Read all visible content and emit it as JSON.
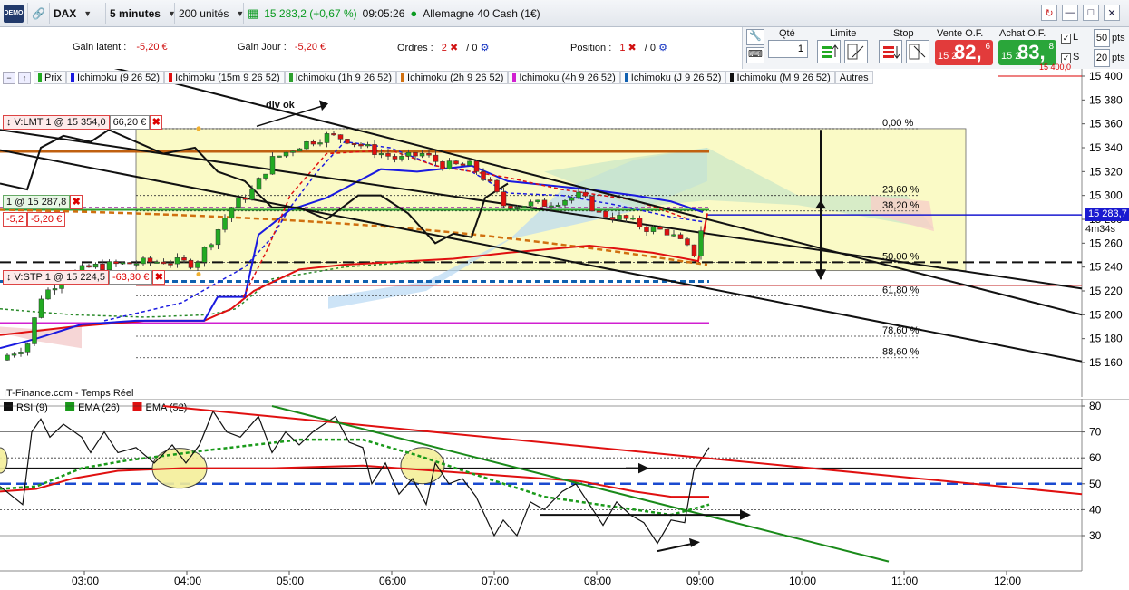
{
  "toolbar": {
    "demo_badge": "DEMO",
    "instrument": "DAX",
    "timeframe": "5 minutes",
    "units": "200 unités",
    "price_change": "15 283,2 (+0,67 %)",
    "time": "09:05:26",
    "instrument_name": "Allemagne 40 Cash (1€)"
  },
  "infobar": {
    "gain_latent_label": "Gain latent :",
    "gain_latent_value": "-5,20 €",
    "gain_jour_label": "Gain Jour :",
    "gain_jour_value": "-5,20 €",
    "ordres_label": "Ordres :",
    "ordres_count": "2",
    "ordres_zero": "/ 0",
    "position_label": "Position :",
    "position_count": "1",
    "position_zero": "/ 0"
  },
  "trade": {
    "qte_label": "Qté",
    "qte_value": "1",
    "limite_label": "Limite",
    "stop_label": "Stop",
    "vente_label": "Vente O.F.",
    "achat_label": "Achat O.F.",
    "vente_small": "15 2",
    "vente_big": "82,",
    "vente_sup": "6",
    "achat_small": "15 2",
    "achat_big": "83,",
    "achat_sup": "8",
    "l_label": "L",
    "l_value": "50",
    "s_label": "S",
    "s_value": "20",
    "pts": "pts",
    "colors": {
      "vente": "#e23b3b",
      "achat": "#2aa63a"
    }
  },
  "legend": {
    "items": [
      {
        "label": "Prix",
        "color": "#22aa22"
      },
      {
        "label": "Ichimoku (9 26 52)",
        "color": "#1a1ae0"
      },
      {
        "label": "Ichimoku (15m 9 26 52)",
        "color": "#e01010"
      },
      {
        "label": "Ichimoku (1h 9 26 52)",
        "color": "#2ea02e"
      },
      {
        "label": "Ichimoku (2h 9 26 52)",
        "color": "#d07010"
      },
      {
        "label": "Ichimoku (4h 9 26 52)",
        "color": "#d020d0"
      },
      {
        "label": "Ichimoku (J 9 26 52)",
        "color": "#1060b0"
      },
      {
        "label": "Ichimoku (M 9 26 52)",
        "color": "#111111"
      }
    ],
    "more": "Autres"
  },
  "main_chart": {
    "price_axis": [
      "15 400",
      "15 380",
      "15 360",
      "15 340",
      "15 320",
      "15 300",
      "15 280",
      "15 260",
      "15 240",
      "15 220",
      "15 200",
      "15 180",
      "15 160"
    ],
    "top_partial": "15 400,0",
    "fibo": [
      "0,00 %",
      "23,60 %",
      "38,20 %",
      "50,00 %",
      "61,80 %",
      "78,60 %",
      "88,60 %"
    ],
    "annotation": "div ok",
    "current_price": "15 283,7",
    "countdown": "4m34s",
    "source": "IT-Finance.com - Temps Réel"
  },
  "orders": {
    "limit": {
      "label": "V:LMT  1 @ 15 354,0",
      "pnl": "66,20 €"
    },
    "position": {
      "label": "1 @ 15 287,8",
      "pnl_left": "-5,2",
      "pnl": "-5,20 €"
    },
    "stop": {
      "label": "V:STP  1 @ 15 224,5",
      "pnl": "-63,30 €"
    }
  },
  "rsi_chart": {
    "legend": [
      {
        "label": "RSI (9)",
        "color": "#111111"
      },
      {
        "label": "EMA (26)",
        "color": "#1a9a1a"
      },
      {
        "label": "EMA (52)",
        "color": "#e01010"
      }
    ],
    "axis": [
      "80",
      "70",
      "60",
      "50",
      "40",
      "30"
    ]
  },
  "time_axis": [
    "03:00",
    "04:00",
    "05:00",
    "06:00",
    "07:00",
    "08:00",
    "09:00",
    "10:00",
    "11:00",
    "12:00"
  ]
}
